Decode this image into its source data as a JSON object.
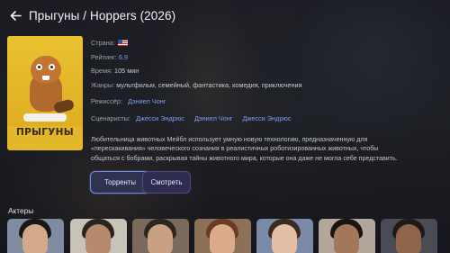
{
  "header": {
    "title": "Прыгуны / Hoppers (2026)"
  },
  "poster": {
    "title": "ПРЫГУНЫ"
  },
  "details": {
    "country_label": "Страна:",
    "rating_label": "Рейтинг:",
    "rating_value": "6.9",
    "runtime_label": "Время:",
    "runtime_value": "105 мин",
    "genres_label": "Жанры:",
    "genres_value": "мультфильм, семейный, фантастика, комедия, приключения",
    "director_label": "Режиссёр:",
    "directors": [
      "Дэниел Чонг"
    ],
    "writers_label": "Сценаристы:",
    "writers": [
      "Джесси Эндрюс",
      "Дэниел Чонг",
      "Джесси Эндрюс"
    ]
  },
  "description": {
    "line1": "Любительница животных Мейбл использует умную новую технологию, предназначенную для",
    "line2": "«перескакивания» человеческого сознания в реалистичных роботизированных животных, чтобы",
    "line3": "общаться с бобрами, раскрывая тайны животного мира, которые она даже не могла себе представить."
  },
  "buttons": {
    "torrents": "Торренты",
    "watch": "Смотреть"
  },
  "actors": {
    "title": "Актеры",
    "count_visible": 7
  },
  "colors": {
    "accent": "#7f9cf0",
    "primary_button_border": "#7487da",
    "poster_yellow": "#e3b72a"
  }
}
